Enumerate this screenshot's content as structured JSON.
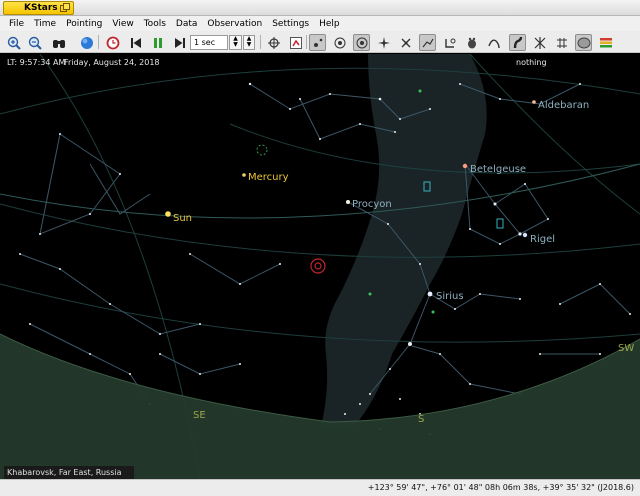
{
  "window": {
    "app_title": "KStars"
  },
  "menubar": {
    "items": [
      "File",
      "Time",
      "Pointing",
      "View",
      "Tools",
      "Data",
      "Observation",
      "Settings",
      "Help"
    ]
  },
  "toolbar": {
    "time_step": "1 sec",
    "buttons": [
      {
        "name": "zoom-in-icon",
        "active": false
      },
      {
        "name": "zoom-out-icon",
        "active": false
      },
      {
        "name": "find-object-icon",
        "active": false
      },
      {
        "name": "globe-icon",
        "active": false
      },
      {
        "name": "set-time-icon",
        "active": false
      },
      {
        "name": "step-back-icon",
        "active": false
      },
      {
        "name": "pause-icon",
        "active": false
      },
      {
        "name": "step-forward-icon",
        "active": false
      },
      {
        "name": "horizon-coords-icon",
        "active": false
      },
      {
        "name": "fov-icon",
        "active": false
      },
      {
        "name": "stars-icon",
        "active": true
      },
      {
        "name": "deep-sky-icon",
        "active": false
      },
      {
        "name": "solar-system-icon",
        "active": true
      },
      {
        "name": "comet-icon",
        "active": false
      },
      {
        "name": "satellite-icon",
        "active": false
      },
      {
        "name": "constellation-lines-icon",
        "active": true
      },
      {
        "name": "constellation-art-icon",
        "active": false
      },
      {
        "name": "constellation-names-icon",
        "active": false
      },
      {
        "name": "asteroid-icon",
        "active": false
      },
      {
        "name": "milky-way-icon",
        "active": true
      },
      {
        "name": "supernovae-icon",
        "active": false
      },
      {
        "name": "equatorial-grid-icon",
        "active": false
      },
      {
        "name": "ground-icon",
        "active": true
      },
      {
        "name": "color-scheme-icon",
        "active": false
      }
    ]
  },
  "sky": {
    "local_time": "LT: 9:57:34 AM",
    "local_date": "Friday, August 24, 2018",
    "focus": "nothing",
    "labels": [
      {
        "text": "Aldebaran",
        "kind": "star"
      },
      {
        "text": "Mercury",
        "kind": "planet"
      },
      {
        "text": "Betelgeuse",
        "kind": "star"
      },
      {
        "text": "Procyon",
        "kind": "star"
      },
      {
        "text": "Sun",
        "kind": "planet"
      },
      {
        "text": "Rigel",
        "kind": "star"
      },
      {
        "text": "Sirius",
        "kind": "star"
      }
    ],
    "compass": [
      "SW",
      "SE",
      "S"
    ],
    "location": "Khabarovsk, Far East, Russia"
  },
  "colors": {
    "star_label": "#8fb0c0",
    "planet_label": "#e8c438",
    "horizon": "#2e4a3a",
    "grid": "#1d3f3c",
    "cardinal": "#9aa64a"
  },
  "statusbar": {
    "coords": "+123° 59' 47\", +76° 01' 48\"  08h 06m 38s, +39° 35' 32\" (J2018.6)"
  }
}
